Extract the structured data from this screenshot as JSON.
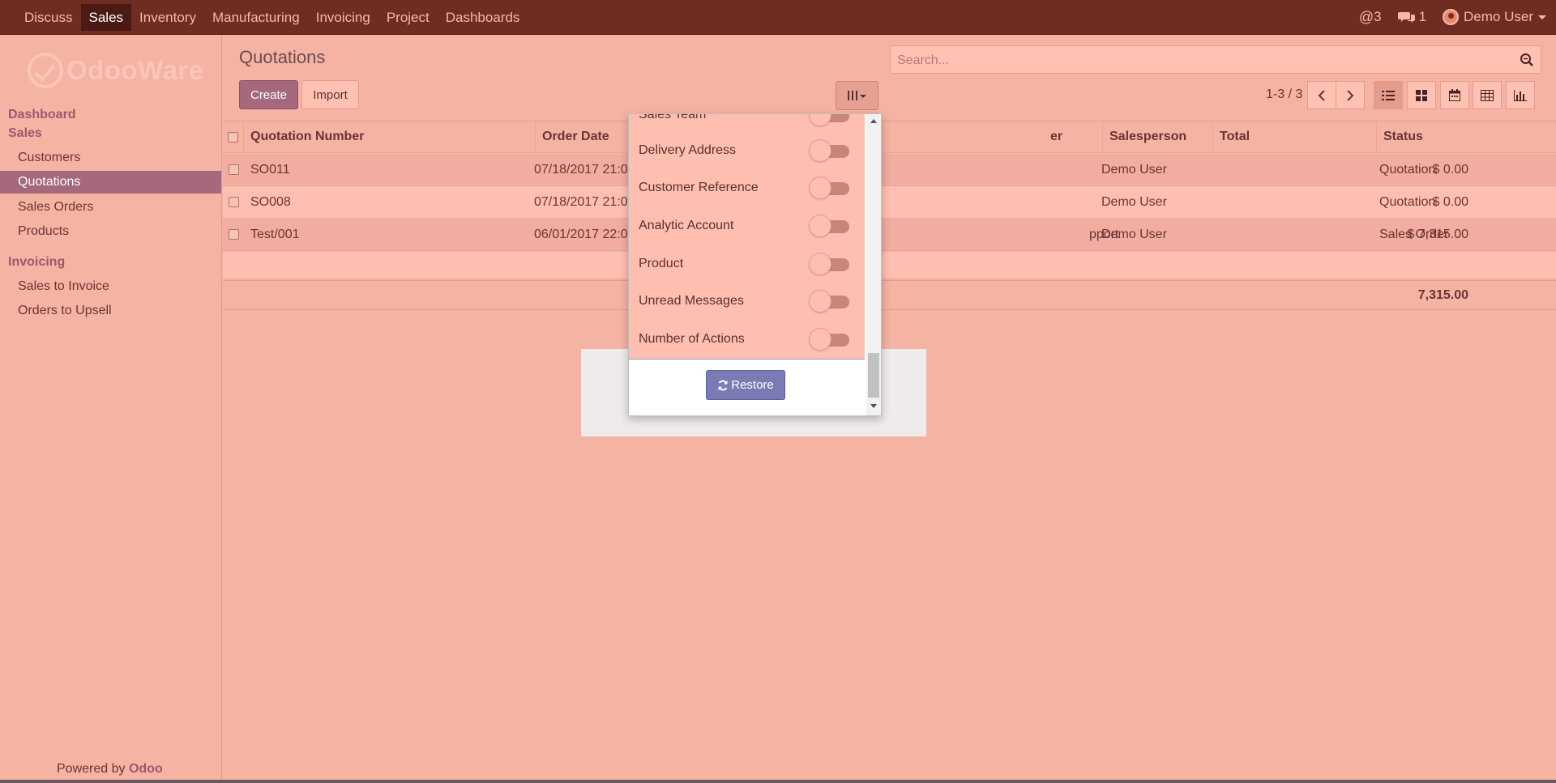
{
  "topbar": {
    "menu": [
      "Discuss",
      "Sales",
      "Inventory",
      "Manufacturing",
      "Invoicing",
      "Project",
      "Dashboards"
    ],
    "active_index": 1,
    "mentions_count": "3",
    "messages_count": "1",
    "user_name": "Demo User",
    "icons": {
      "mention": "at-icon",
      "messages": "comments-icon",
      "user": "avatar"
    }
  },
  "sidebar": {
    "logo_text": "OdooWare",
    "sections": [
      {
        "title": "Dashboard",
        "items": []
      },
      {
        "title": "Sales",
        "items": [
          "Customers",
          "Quotations",
          "Sales Orders",
          "Products"
        ]
      },
      {
        "title": "Invoicing",
        "items": [
          "Sales to Invoice",
          "Orders to Upsell"
        ]
      }
    ],
    "active_item": "Quotations",
    "powered_prefix": "Powered by",
    "powered_brand": "Odoo"
  },
  "control_panel": {
    "title": "Quotations",
    "create_label": "Create",
    "import_label": "Import",
    "search_placeholder": "Search...",
    "pager_value": "1-3 / 3",
    "views": [
      "list-view-icon",
      "kanban-view-icon",
      "calendar-view-icon",
      "pivot-view-icon",
      "graph-view-icon"
    ],
    "active_view": "list-view-icon"
  },
  "table": {
    "columns": [
      "Quotation Number",
      "Order Date",
      "Customer",
      "Salesperson",
      "Total",
      "Status"
    ],
    "rows": [
      {
        "number": "SO011",
        "date": "07/18/2017 21:0",
        "customer": "",
        "salesperson": "Demo User",
        "total": "$ 0.00",
        "status": "Quotation"
      },
      {
        "number": "SO008",
        "date": "07/18/2017 21:0",
        "customer": "",
        "salesperson": "Demo User",
        "total": "$ 0.00",
        "status": "Quotation"
      },
      {
        "number": "Test/001",
        "date": "06/01/2017 22:0",
        "customer": "pport",
        "salesperson": "Demo User",
        "total": "$ 7,315.00",
        "status": "Sales Order"
      }
    ],
    "grand_total": "7,315.00"
  },
  "column_dropdown": {
    "items": [
      "Sales Team",
      "Delivery Address",
      "Customer Reference",
      "Analytic Account",
      "Product",
      "Unread Messages",
      "Number of Actions"
    ],
    "restore_label": "Restore"
  },
  "colors": {
    "navbar": "#6e2c22",
    "background": "#f5b3a3",
    "primary": "#a5687c",
    "restore_button": "#7a7ab4"
  }
}
